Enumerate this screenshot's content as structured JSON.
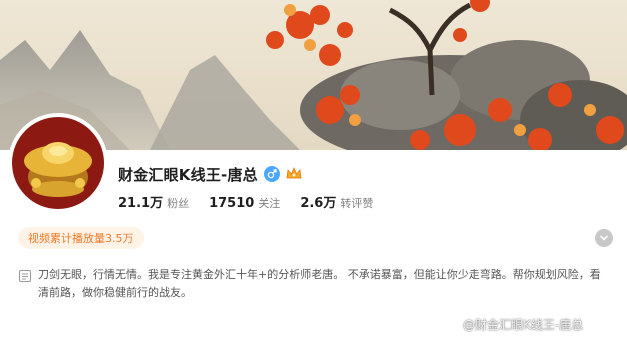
{
  "profile": {
    "name": "财金汇眼K线王-唐总",
    "gender_icon": "male-icon",
    "level_icon": "crown-badge-icon",
    "accent_color": "#f07a27"
  },
  "stats": [
    {
      "value": "21.1万",
      "label": "粉丝"
    },
    {
      "value": "17510",
      "label": "关注"
    },
    {
      "value": "2.6万",
      "label": "转评赞"
    }
  ],
  "badge": {
    "text": "视频累计播放量3.5万"
  },
  "bio": {
    "icon": "bio-text-icon",
    "text": "刀剑无眼，行情无情。我是专注黄金外汇十年+的分析师老唐。 不承诺暴富，但能让你少走弯路。帮你规划风险，看清前路，做你稳健前行的战友。"
  },
  "expand": {
    "icon": "chevron-down-icon"
  },
  "watermark": {
    "text": "@财金汇眼K线王-唐总"
  }
}
